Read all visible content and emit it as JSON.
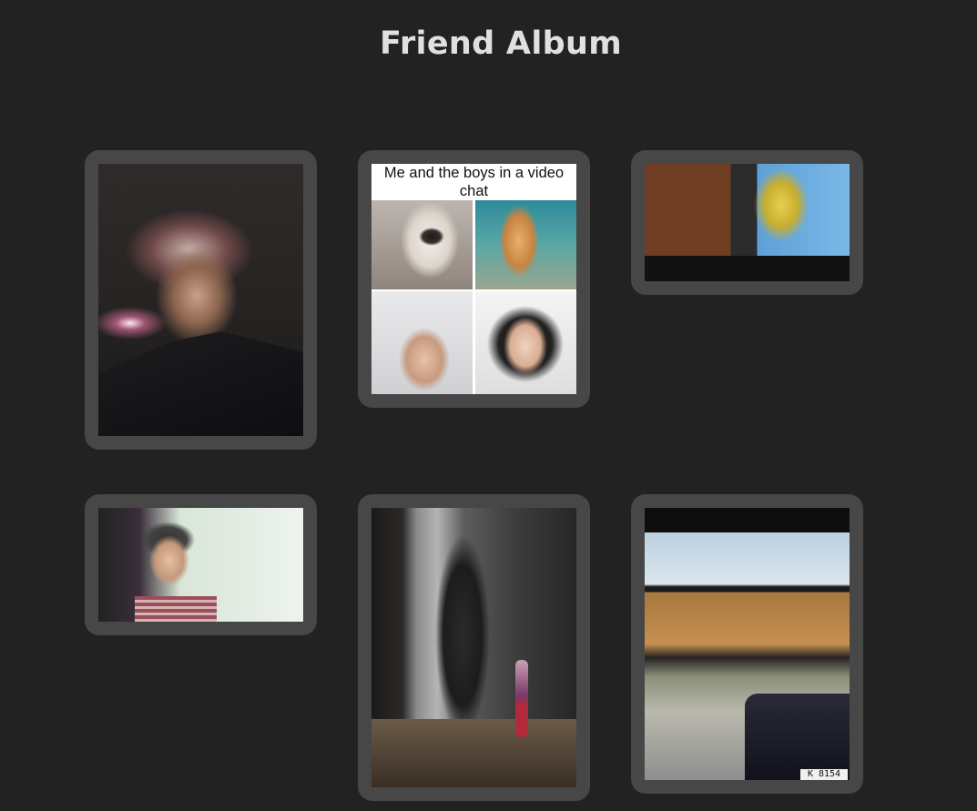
{
  "page": {
    "title": "Friend Album",
    "background_color": "#222222",
    "card_color": "#474747"
  },
  "photos": [
    {
      "subject": "selfie"
    },
    {
      "subject": "meme",
      "caption": "Me and the boys in a video chat"
    },
    {
      "subject": "room"
    },
    {
      "subject": "webcam"
    },
    {
      "subject": "dark-hall"
    },
    {
      "subject": "car-interior",
      "plate_text": "K 8154"
    }
  ]
}
